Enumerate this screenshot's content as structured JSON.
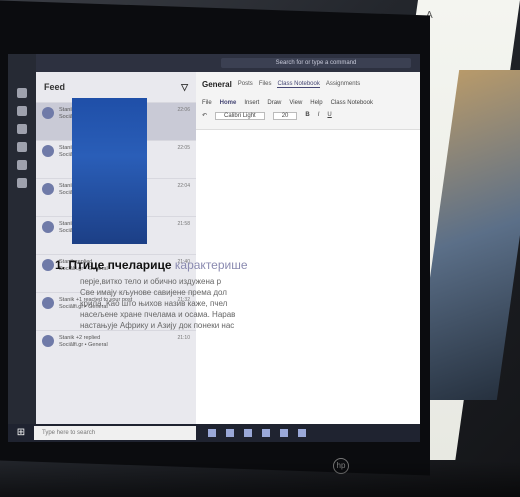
{
  "topbar": {
    "search_placeholder": "Search for or type a command"
  },
  "feed": {
    "title": "Feed",
    "items": [
      {
        "who": "Stanik +1 replied",
        "sub": "Sociălfi.gr • General",
        "time": "22:06"
      },
      {
        "who": "Stanik +2 replied to your post",
        "sub": "Sociălfi.gr • General",
        "time": "22:05"
      },
      {
        "who": "Stanik +2 replied",
        "sub": "Sociălfi.gr • General",
        "time": "22:04"
      },
      {
        "who": "Stanik reacted to your reply",
        "sub": "Sociălfi.gr • General",
        "time": "21:58"
      },
      {
        "who": "Stanik replied",
        "sub": "Sociălfi.gr • General",
        "time": "21:40"
      },
      {
        "who": "Stanik +1 reacted to your post",
        "sub": "Sociălfi.gr • General",
        "time": "21:32"
      },
      {
        "who": "Stanik +2 replied",
        "sub": "Sociălfi.gr • General",
        "time": "21:10"
      }
    ]
  },
  "channel": {
    "name": "General",
    "tabs": [
      "Posts",
      "Files",
      "Class Notebook",
      "Assignments"
    ]
  },
  "ribbon": {
    "tabs": [
      "File",
      "Home",
      "Insert",
      "Draw",
      "View",
      "Help",
      "Class Notebook"
    ],
    "font": "Calibri Light",
    "size": "20"
  },
  "page": {
    "heading_bold": "1.  Птице пчеларице",
    "heading_rest": " карактерише",
    "lines": [
      "перје,витко тело и обично издужена р",
      "Све имају кљунове савијене према дол",
      "крила. Као што њихов назив каже, пчел",
      "насељене хране пчелама и осама. Нарав",
      "настањује Африку и Азију док понеки нас"
    ]
  },
  "taskbar": {
    "search": "Type here to search"
  },
  "right": {
    "corner": "A"
  },
  "colors": {
    "teams_accent": "#464775",
    "rail": "#262a34"
  }
}
